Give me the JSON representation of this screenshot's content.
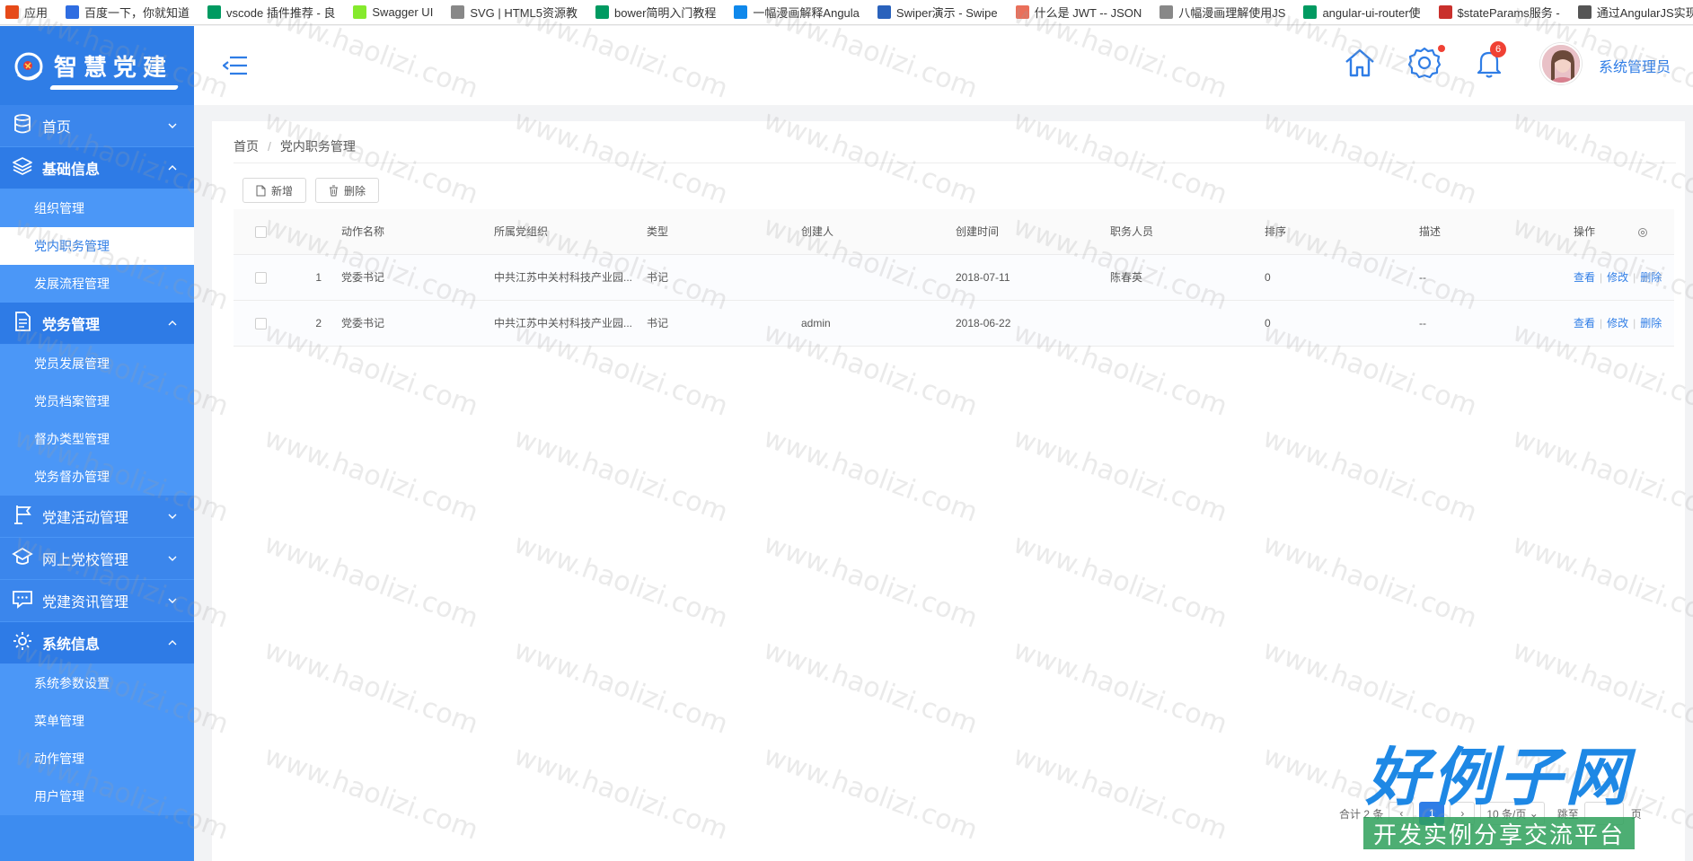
{
  "bookmarks": [
    {
      "label": "应用",
      "icon": "apps-grid-icon",
      "color": "#e64a19"
    },
    {
      "label": "百度一下，你就知道",
      "icon": "baidu-paw-icon",
      "color": "#2f6de1"
    },
    {
      "label": "vscode 插件推荐 - 良",
      "icon": "sf-icon",
      "color": "#009a61"
    },
    {
      "label": "Swagger UI",
      "icon": "swagger-icon",
      "color": "#85ea2d"
    },
    {
      "label": "SVG | HTML5资源教",
      "icon": "page-icon",
      "color": "#888888"
    },
    {
      "label": "bower简明入门教程",
      "icon": "sf-icon",
      "color": "#009a61"
    },
    {
      "label": "一幅漫画解释Angula",
      "icon": "zhihu-icon",
      "color": "#0f88eb"
    },
    {
      "label": "Swiper演示 - Swipe",
      "icon": "swiper-icon",
      "color": "#2a62bc"
    },
    {
      "label": "什么是 JWT -- JSON",
      "icon": "jianshu-icon",
      "color": "#ea6f5a"
    },
    {
      "label": "八幅漫画理解使用JS",
      "icon": "page-icon",
      "color": "#888888"
    },
    {
      "label": "angular-ui-router使",
      "icon": "sf-icon",
      "color": "#009a61"
    },
    {
      "label": "$stateParams服务 -",
      "icon": "csdn-icon",
      "color": "#c9302c"
    },
    {
      "label": "通过AngularJS实现图",
      "icon": "link-icon",
      "color": "#555555"
    }
  ],
  "sidebar": {
    "logo_text": "智慧党建",
    "groups": [
      {
        "label": "首页",
        "icon": "database-icon",
        "open": false,
        "items": []
      },
      {
        "label": "基础信息",
        "icon": "layers-icon",
        "open": true,
        "items": [
          "组织管理",
          "党内职务管理",
          "发展流程管理"
        ]
      },
      {
        "label": "党务管理",
        "icon": "document-icon",
        "open": true,
        "items": [
          "党员发展管理",
          "党员档案管理",
          "督办类型管理",
          "党务督办管理"
        ]
      },
      {
        "label": "党建活动管理",
        "icon": "flag-icon",
        "open": false,
        "items": []
      },
      {
        "label": "网上党校管理",
        "icon": "school-icon",
        "open": false,
        "items": []
      },
      {
        "label": "党建资讯管理",
        "icon": "chat-icon",
        "open": false,
        "items": []
      },
      {
        "label": "系统信息",
        "icon": "settings-cog-icon",
        "open": true,
        "items": [
          "系统参数设置",
          "菜单管理",
          "动作管理",
          "用户管理"
        ]
      }
    ],
    "active_item": "党内职务管理"
  },
  "header": {
    "notification_count": "6",
    "username": "系统管理员"
  },
  "breadcrumb": {
    "home": "首页",
    "separator": "/",
    "current": "党内职务管理"
  },
  "toolbar": {
    "add_label": "新增",
    "delete_label": "删除"
  },
  "table": {
    "columns": [
      "动作名称",
      "所属党组织",
      "类型",
      "创建人",
      "创建时间",
      "职务人员",
      "排序",
      "描述",
      "操作"
    ],
    "rows": [
      {
        "index": "1",
        "name": "党委书记",
        "org": "中共江苏中关村科技产业园...",
        "type": "书记",
        "creator": "",
        "created": "2018-07-11",
        "staff": "陈春英",
        "order": "0",
        "desc": "--"
      },
      {
        "index": "2",
        "name": "党委书记",
        "org": "中共江苏中关村科技产业园...",
        "type": "书记",
        "creator": "admin",
        "created": "2018-06-22",
        "staff": "",
        "order": "0",
        "desc": "--"
      }
    ],
    "actions": {
      "view": "查看",
      "edit": "修改",
      "delete": "删除"
    }
  },
  "pagination": {
    "total": "合计 2 条",
    "current_page": "1",
    "page_size": "10 条/页",
    "jump_label": "跳至",
    "page_unit": "页"
  },
  "watermark": {
    "text": "www.haolizi.com",
    "logo_title": "好例子网",
    "logo_sub": "开发实例分享交流平台"
  },
  "colors": {
    "sidebar": "#3d8cf0",
    "accent": "#2f7de6",
    "badge": "#f04134"
  }
}
